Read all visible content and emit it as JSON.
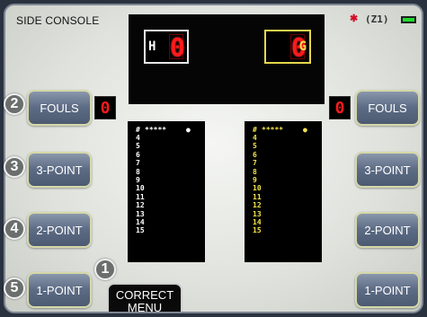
{
  "console_title": "SIDE CONSOLE",
  "status": {
    "flag_icon": "uk-flag-icon",
    "signal_text": "(Z1)",
    "battery_icon": "battery-icon",
    "battery_color": "#1ddb2b"
  },
  "scoreboard": {
    "home": {
      "letter": "H",
      "score": "0"
    },
    "guest": {
      "letter": "G",
      "score": "0"
    },
    "score_color": "#ff1a1a"
  },
  "home_fouls": "0",
  "guest_fouls": "0",
  "buttons": {
    "fouls": "FOULS",
    "three_point": "3-POINT",
    "two_point": "2-POINT",
    "one_point": "1-POINT"
  },
  "correct_menu": {
    "line1": "CORRECT",
    "line2": "MENU"
  },
  "badges": {
    "correct": "1",
    "fouls": "2",
    "three": "3",
    "two": "4",
    "one": "5"
  },
  "roster_home": {
    "header": {
      "hash": "#",
      "stars": "*****",
      "dot": "●"
    },
    "players": [
      "4",
      "5",
      "6",
      "7",
      "8",
      "9",
      "10",
      "11",
      "12",
      "13",
      "14",
      "15"
    ]
  },
  "roster_guest": {
    "header": {
      "hash": "#",
      "stars": "*****",
      "dot": "●"
    },
    "players": [
      "4",
      "5",
      "6",
      "7",
      "8",
      "9",
      "10",
      "11",
      "12",
      "13",
      "14",
      "15"
    ]
  },
  "colors": {
    "home": "#ffffff",
    "guest": "#f2e24b",
    "button_border": "#d5d8a8"
  }
}
